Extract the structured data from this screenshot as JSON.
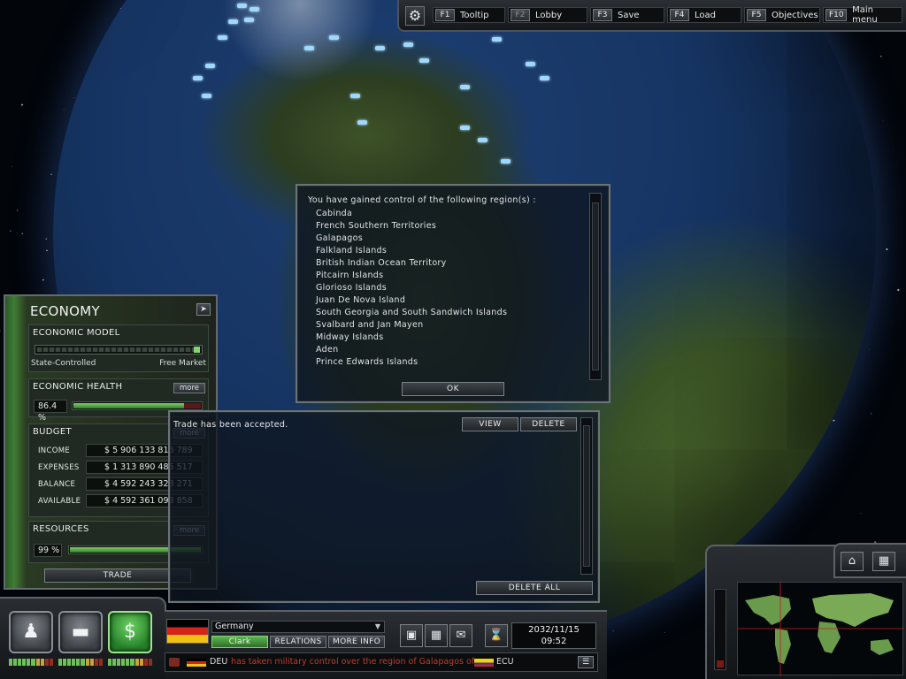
{
  "topbar": {
    "hotkeys": [
      {
        "key": "F1",
        "label": "Tooltip",
        "enabled": true
      },
      {
        "key": "F2",
        "label": "Lobby",
        "enabled": false
      },
      {
        "key": "F3",
        "label": "Save",
        "enabled": true
      },
      {
        "key": "F4",
        "label": "Load",
        "enabled": true
      },
      {
        "key": "F5",
        "label": "Objectives",
        "enabled": true
      },
      {
        "key": "F10",
        "label": "Main menu",
        "enabled": true
      }
    ],
    "settings_icon": "gear-icon"
  },
  "regions_dialog": {
    "intro": "You have gained control of the following region(s) :",
    "regions": [
      "Cabinda",
      "French Southern Territories",
      "Galapagos",
      "Falkland Islands",
      "British Indian Ocean Territory",
      "Pitcairn Islands",
      "Glorioso Islands",
      "Juan De Nova Island",
      "South Georgia and South Sandwich Islands",
      "Svalbard and Jan Mayen",
      "Midway Islands",
      "Aden",
      "Prince Edwards Islands"
    ],
    "ok_label": "OK"
  },
  "economy": {
    "title": "ECONOMY",
    "model": {
      "heading": "ECONOMIC MODEL",
      "left_label": "State-Controlled",
      "right_label": "Free Market",
      "position": 1.0
    },
    "health": {
      "heading": "ECONOMIC HEALTH",
      "more_label": "more",
      "value_text": "86.4 %",
      "value": 0.864
    },
    "budget": {
      "heading": "BUDGET",
      "more_label": "more",
      "rows": [
        {
          "label": "INCOME",
          "value": "$ 5 906 133 816 789"
        },
        {
          "label": "EXPENSES",
          "value": "$ 1 313 890 485 517"
        },
        {
          "label": "BALANCE",
          "value": "$ 4 592 243 328 271"
        },
        {
          "label": "AVAILABLE",
          "value": "$ 4 592 361 098 858"
        }
      ]
    },
    "resources": {
      "heading": "RESOURCES",
      "more_label": "more",
      "value_text": "99 %",
      "value": 0.99
    },
    "trade_label": "TRADE"
  },
  "trade_panel": {
    "message": "Trade has been accepted.",
    "view_label": "VIEW",
    "delete_label": "DELETE",
    "delete_all_label": "DELETE ALL"
  },
  "categories": [
    {
      "name": "politics",
      "icon": "podium-icon",
      "active": false
    },
    {
      "name": "military",
      "icon": "tank-icon",
      "active": false
    },
    {
      "name": "economy",
      "icon": "dollar-icon",
      "active": true
    }
  ],
  "country_bar": {
    "country": "Germany",
    "leader": "Clark",
    "relations_label": "RELATIONS",
    "more_info_label": "MORE INFO",
    "date": "2032/11/15",
    "time": "09:52",
    "flag_colors": [
      "#000000",
      "#d8231a",
      "#f1c214"
    ]
  },
  "ticker": {
    "source_code": "DEU",
    "message": "has taken military control over the region of Galapagos of",
    "target_code": "ECU"
  },
  "colors": {
    "accent_green": "#3f7d33",
    "alert_red": "#c23b2a",
    "unit_blue": "#9fd8ff"
  }
}
